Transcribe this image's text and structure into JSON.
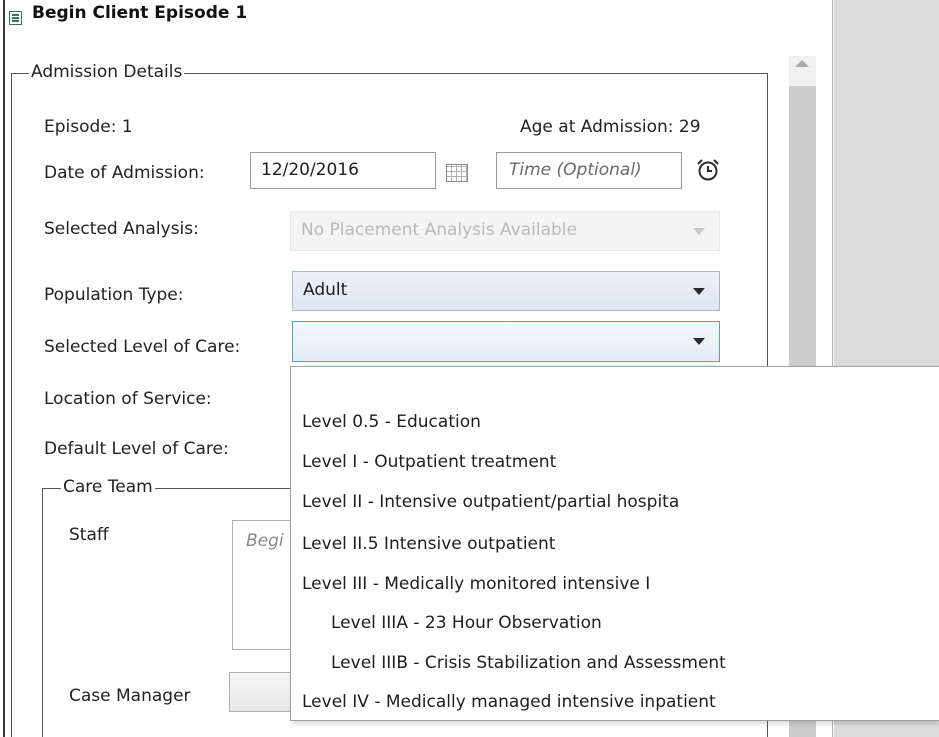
{
  "window": {
    "title": "Begin Client Episode 1"
  },
  "admission": {
    "group_label": "Admission Details",
    "episode_label": "Episode: 1",
    "age_label": "Age at Admission: 29",
    "date_label": "Date of Admission:",
    "date_value": "12/20/2016",
    "time_placeholder": "Time (Optional)",
    "analysis_label": "Selected Analysis:",
    "analysis_value": "No Placement Analysis Available",
    "population_label": "Population Type:",
    "population_value": "Adult",
    "level_label": "Selected Level of Care:",
    "level_value": "",
    "location_label": "Location of Service:",
    "default_level_label": "Default Level of Care:"
  },
  "care_team": {
    "group_label": "Care Team",
    "staff_label": "Staff",
    "staff_placeholder": "Begi",
    "case_manager_label": "Case Manager"
  },
  "level_options": [
    "Level 0.5 - Education",
    "Level I - Outpatient treatment",
    "Level II - Intensive outpatient/partial hospita",
    "Level II.5 Intensive outpatient",
    "Level III - Medically monitored intensive I",
    "Level IIIA - 23 Hour Observation",
    "Level IIIB - Crisis Stabilization and Assessment",
    "Level IV - Medically managed intensive inpatient"
  ],
  "icons": {
    "title": "form-icon",
    "calendar": "calendar-icon",
    "clock": "alarm-clock-icon",
    "dropdown": "chevron-down-icon"
  },
  "colors": {
    "accent": "#5b9ad8",
    "title_icon": "#2f7a5b",
    "side_panel": "#dcdcdc"
  }
}
